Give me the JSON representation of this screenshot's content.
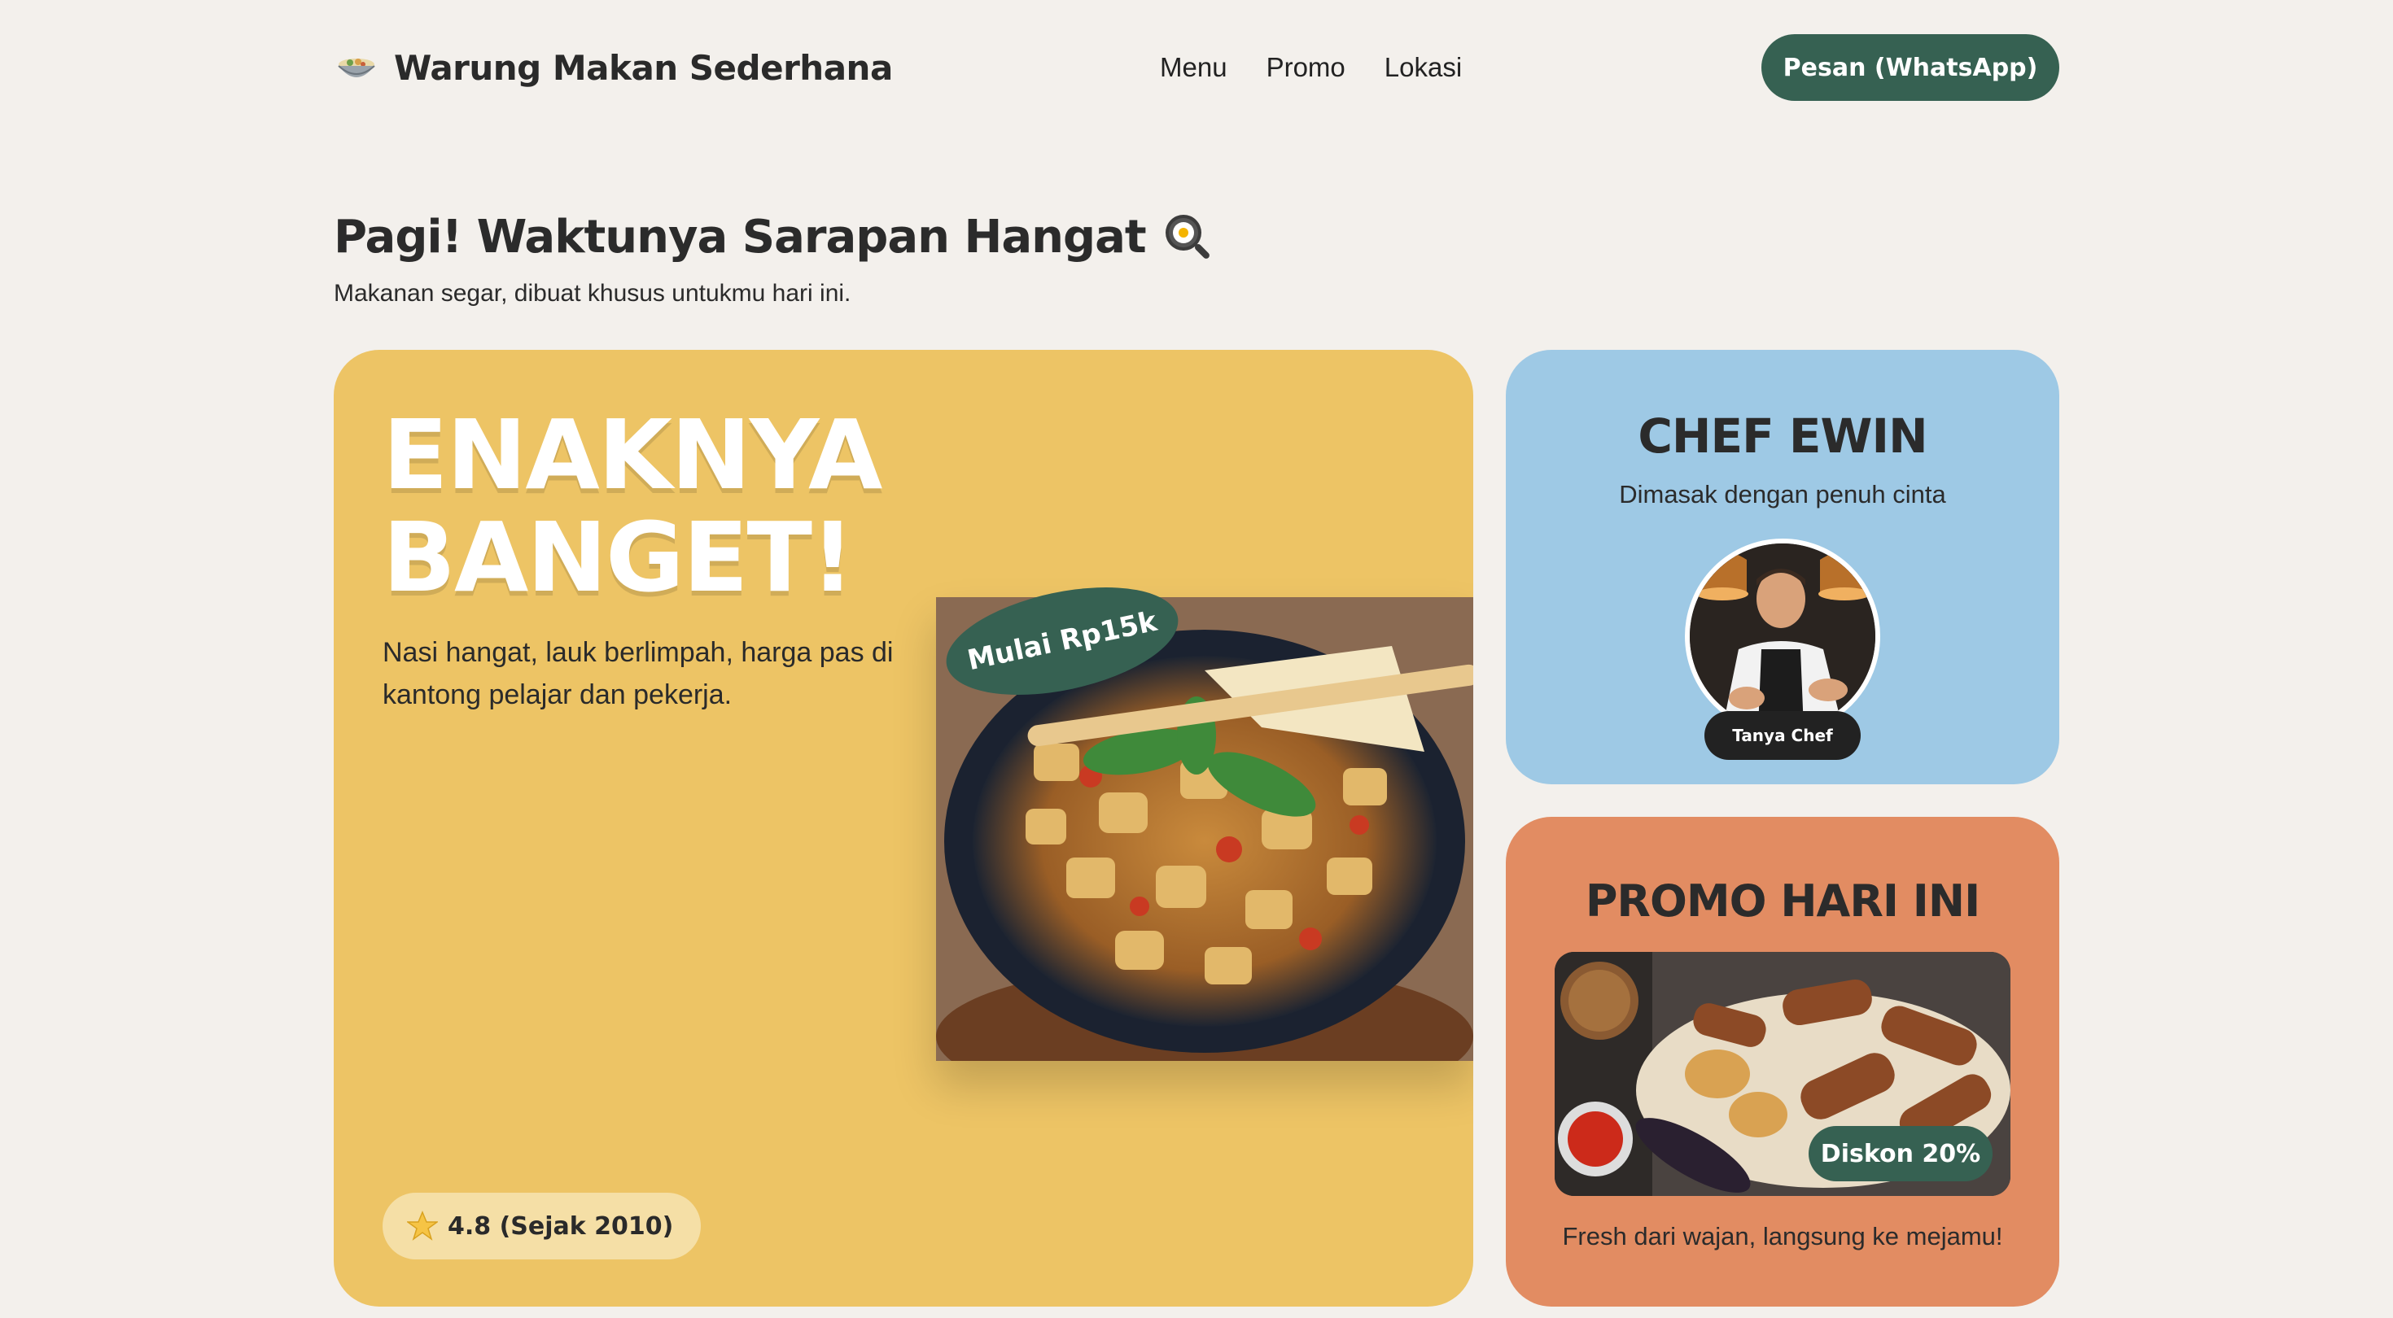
{
  "header": {
    "brand_icon": "bowl-icon",
    "brand_name": "Warung Makan Sederhana",
    "nav": [
      "Menu",
      "Promo",
      "Lokasi"
    ],
    "cta_label": "Pesan (WhatsApp)"
  },
  "greeting": {
    "title": "Pagi! Waktunya Sarapan Hangat",
    "icon": "frying-pan-egg-icon",
    "subtitle": "Makanan segar, dibuat khusus untukmu hari ini."
  },
  "hero": {
    "title_line1": "ENAKNYA",
    "title_line2": "BANGET!",
    "description": "Nasi hangat, lauk berlimpah, harga pas di kantong pelajar dan pekerja.",
    "price_tag": "Mulai Rp15k",
    "rating_icon": "star-icon",
    "rating": "4.8 (Sejak 2010)"
  },
  "chef": {
    "title": "CHEF EWIN",
    "subtitle": "Dimasak dengan penuh cinta",
    "button": "Tanya Chef"
  },
  "promo": {
    "title": "PROMO HARI INI",
    "discount": "Diskon 20%",
    "caption": "Fresh dari wajan, langsung ke mejamu!"
  },
  "colors": {
    "background": "#f3f0ec",
    "primary_green": "#366152",
    "hero_yellow": "#edc465",
    "chef_blue": "#9ec9e5",
    "promo_orange": "#e28c62",
    "rating_pill": "#f5dfa6"
  }
}
